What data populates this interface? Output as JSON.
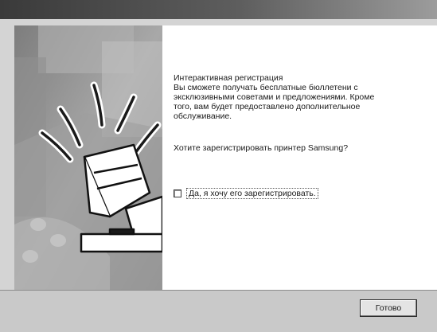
{
  "dialog": {
    "message_title": "Интерактивная регистрация",
    "message_lines": [
      "Вы сможете получать бесплатные бюллетени с",
      "эксклюзивными советами и предложениями. Кроме",
      "того, вам будет предоставлено дополнительное",
      "обслуживание."
    ],
    "question": "Хотите зарегистрировать принтер Samsung?",
    "checkbox": {
      "label": "Да, я хочу его зарегистрировать.",
      "checked": false
    },
    "finish_button_label": "Готово"
  },
  "illustration": {
    "icon": "printer-with-alert-rays-icon"
  }
}
